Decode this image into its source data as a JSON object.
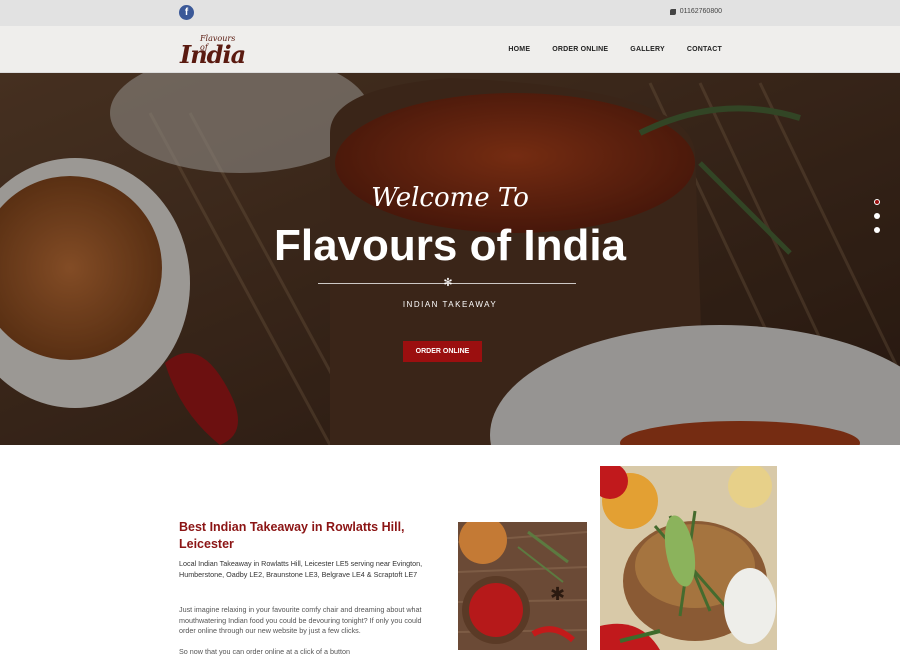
{
  "topbar": {
    "facebook_icon": "facebook-icon",
    "phone_icon": "phone-icon",
    "phone": "01162760800"
  },
  "header": {
    "logo_small": "Flavours of",
    "logo_big": "India",
    "menu": [
      "HOME",
      "ORDER ONLINE",
      "GALLERY",
      "CONTACT"
    ]
  },
  "hero": {
    "welcome": "Welcome To",
    "title": "Flavours of India",
    "subtitle": "INDIAN TAKEAWAY",
    "cta": "ORDER ONLINE",
    "slides": 3,
    "active_slide": 1
  },
  "intro": {
    "heading": "Best Indian Takeaway in Rowlatts Hill, Leicester",
    "paragraph1": "Local Indian Takeaway in Rowlatts Hill, Leicester LE5 serving near Evington, Humberstone, Oadby LE2, Braunstone LE3, Belgrave LE4 & Scraptoft LE7",
    "paragraph2": "Just imagine relaxing in your favourite comfy chair and dreaming about what mouthwatering Indian food you could be devouring tonight? If only you could order online through our new website by just a few clicks.",
    "paragraph3": "So now that you can order online at a click of a button"
  },
  "colors": {
    "brand_red": "#9b0f0f",
    "heading_red": "#8b1414",
    "logo_brown": "#5a1a10"
  }
}
